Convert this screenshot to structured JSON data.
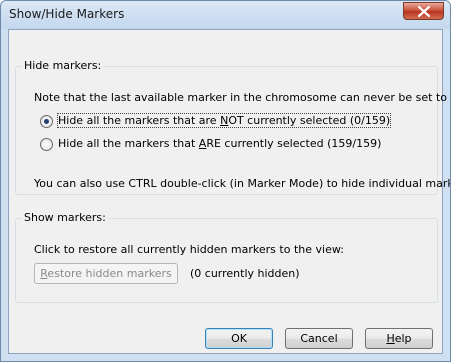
{
  "window": {
    "title": "Show/Hide Markers",
    "close_icon": "close-icon",
    "accent": "#c74a32"
  },
  "hide_group": {
    "label": "Hide markers:",
    "note": "Note that the last available marker in the chromosome can never be set to hidden",
    "options": [
      {
        "pre": "Hide all the markers that are ",
        "key": "N",
        "post": "OT currently selected (0/159)",
        "selected": true
      },
      {
        "pre": "Hide all the markers that ",
        "key": "A",
        "post": "RE currently selected (159/159)",
        "selected": false
      }
    ],
    "tip": "You can also use CTRL double-click (in Marker Mode) to hide individual markers."
  },
  "show_group": {
    "label": "Show markers:",
    "desc": "Click to restore all currently hidden markers to the view:",
    "restore_button": {
      "key": "R",
      "rest": "estore hidden markers"
    },
    "status": "(0 currently hidden)"
  },
  "buttons": {
    "ok": "OK",
    "cancel": "Cancel",
    "help": {
      "key": "H",
      "rest": "elp"
    }
  }
}
